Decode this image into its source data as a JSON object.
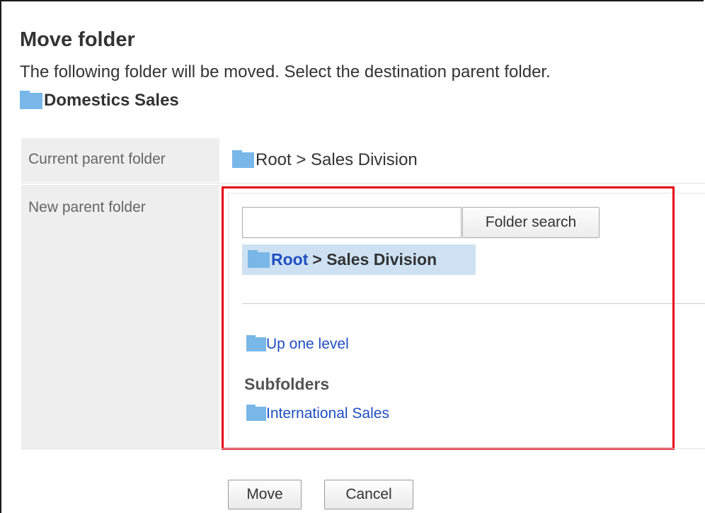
{
  "dialog": {
    "title": "Move folder",
    "description": "The following folder will be moved. Select the destination parent folder.",
    "target_folder": "Domestics Sales"
  },
  "current_parent": {
    "label": "Current parent folder",
    "path": "Root > Sales Division"
  },
  "new_parent": {
    "label": "New parent folder",
    "search": {
      "value": "",
      "placeholder": "",
      "button_label": "Folder search"
    },
    "selected": {
      "root_link": "Root",
      "rest": "> Sales Division"
    },
    "up_one_level": "Up one level",
    "subfolders_heading": "Subfolders",
    "subfolders": [
      "International Sales"
    ]
  },
  "actions": {
    "move_label": "Move",
    "cancel_label": "Cancel"
  },
  "colors": {
    "folder_icon": "#78b7e8",
    "link": "#1f4fc1",
    "selected_bg": "#cde1f3",
    "label_bg": "#eeeeee",
    "highlight_border": "#e60012"
  },
  "icons": {
    "folder": "folder-icon"
  }
}
